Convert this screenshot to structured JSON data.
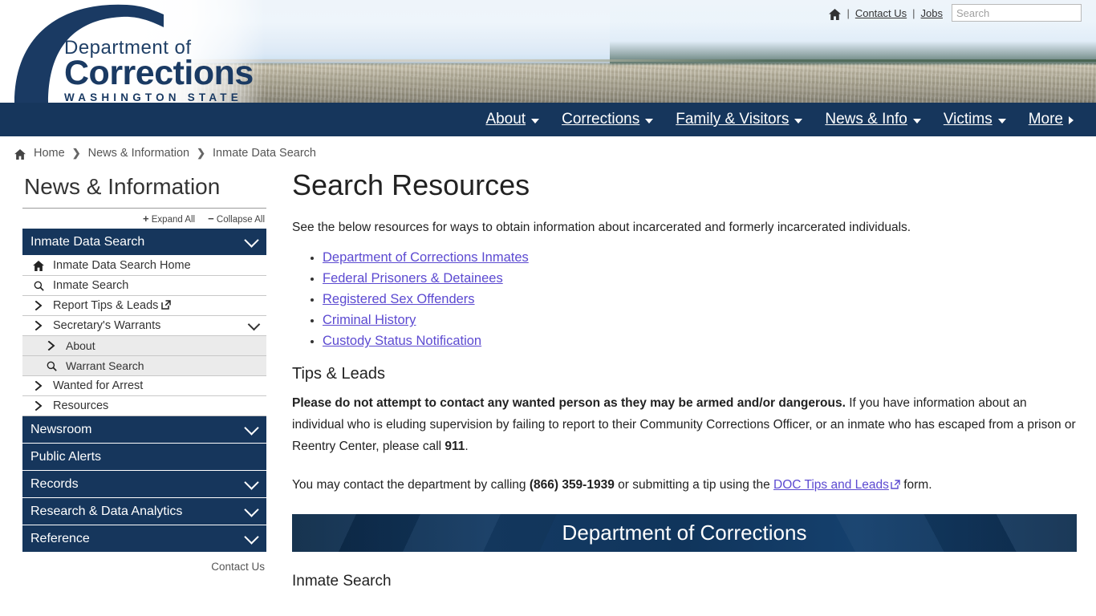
{
  "utility": {
    "home_icon": "home-icon",
    "separator": "|",
    "contact_us": "Contact Us",
    "jobs": "Jobs",
    "search_placeholder": "Search",
    "search_value": "",
    "search_icon": "search-icon"
  },
  "logo": {
    "line1": "Department of",
    "line2": "Corrections",
    "line3": "WASHINGTON STATE"
  },
  "mainnav": {
    "items": [
      {
        "label": "About",
        "caret": "down"
      },
      {
        "label": "Corrections",
        "caret": "down"
      },
      {
        "label": "Family & Visitors",
        "caret": "down"
      },
      {
        "label": "News & Info",
        "caret": "down"
      },
      {
        "label": "Victims",
        "caret": "down"
      },
      {
        "label": "More",
        "caret": "right"
      }
    ]
  },
  "breadcrumb": {
    "home": "Home",
    "level2": "News & Information",
    "level3": "Inmate Data Search",
    "chevron": "❯"
  },
  "sidebar": {
    "title": "News & Information",
    "expand_all": "Expand All",
    "collapse_all": "Collapse All",
    "expand_sign": "+",
    "collapse_sign": "−",
    "section_active": "Inmate Data Search",
    "items": [
      {
        "label": "Inmate Data Search Home",
        "icon": "home-icon",
        "sub": false,
        "external": false
      },
      {
        "label": "Inmate Search",
        "icon": "search-icon",
        "sub": false,
        "external": false
      },
      {
        "label": "Report Tips & Leads",
        "icon": "chevron-right-icon",
        "sub": false,
        "external": true
      },
      {
        "label": "Secretary's Warrants",
        "icon": "chevron-right-icon",
        "sub": false,
        "external": false,
        "expandable": true
      },
      {
        "label": "About",
        "icon": "chevron-right-icon",
        "sub": true,
        "external": false
      },
      {
        "label": "Warrant Search",
        "icon": "search-icon",
        "sub": true,
        "external": false
      },
      {
        "label": "Wanted for Arrest",
        "icon": "chevron-right-icon",
        "sub": false,
        "external": false
      },
      {
        "label": "Resources",
        "icon": "chevron-right-icon",
        "sub": false,
        "external": false
      }
    ],
    "sections": [
      {
        "label": "Newsroom",
        "chevron": true
      },
      {
        "label": "Public Alerts",
        "chevron": false
      },
      {
        "label": "Records",
        "chevron": true
      },
      {
        "label": "Research & Data Analytics",
        "chevron": true
      },
      {
        "label": "Reference",
        "chevron": true
      }
    ],
    "contact_us": "Contact Us"
  },
  "content": {
    "page_title": "Search Resources",
    "lead": "See the below resources for ways to obtain information about incarcerated and formerly incarcerated individuals.",
    "resource_links": [
      "Department of Corrections Inmates",
      "Federal Prisoners & Detainees",
      "Registered Sex Offenders",
      "Criminal History",
      "Custody Status Notification"
    ],
    "tips_heading": "Tips & Leads",
    "tips_bold": "Please do not attempt to contact any wanted person as they may be armed and/or dangerous.",
    "tips_rest_1": " If you have information about an individual who is eluding supervision by failing to report to their Community Corrections Officer, or an inmate who has escaped from a prison or Reentry Center, please call ",
    "tips_911": "911",
    "tips_rest_2": ".",
    "contact_pre": "You may contact the department by calling ",
    "contact_phone": "(866) 359-1939",
    "contact_mid": " or submitting a tip using the ",
    "contact_link": "DOC Tips and Leads",
    "contact_post": " form.",
    "banner_title": "Department of Corrections",
    "subhead": "Inmate Search"
  },
  "colors": {
    "navy": "#16365c",
    "navy_dark": "#0b2947",
    "link_purple": "#5c4ad1",
    "sub_bg": "#ebebeb",
    "text": "#222222"
  }
}
